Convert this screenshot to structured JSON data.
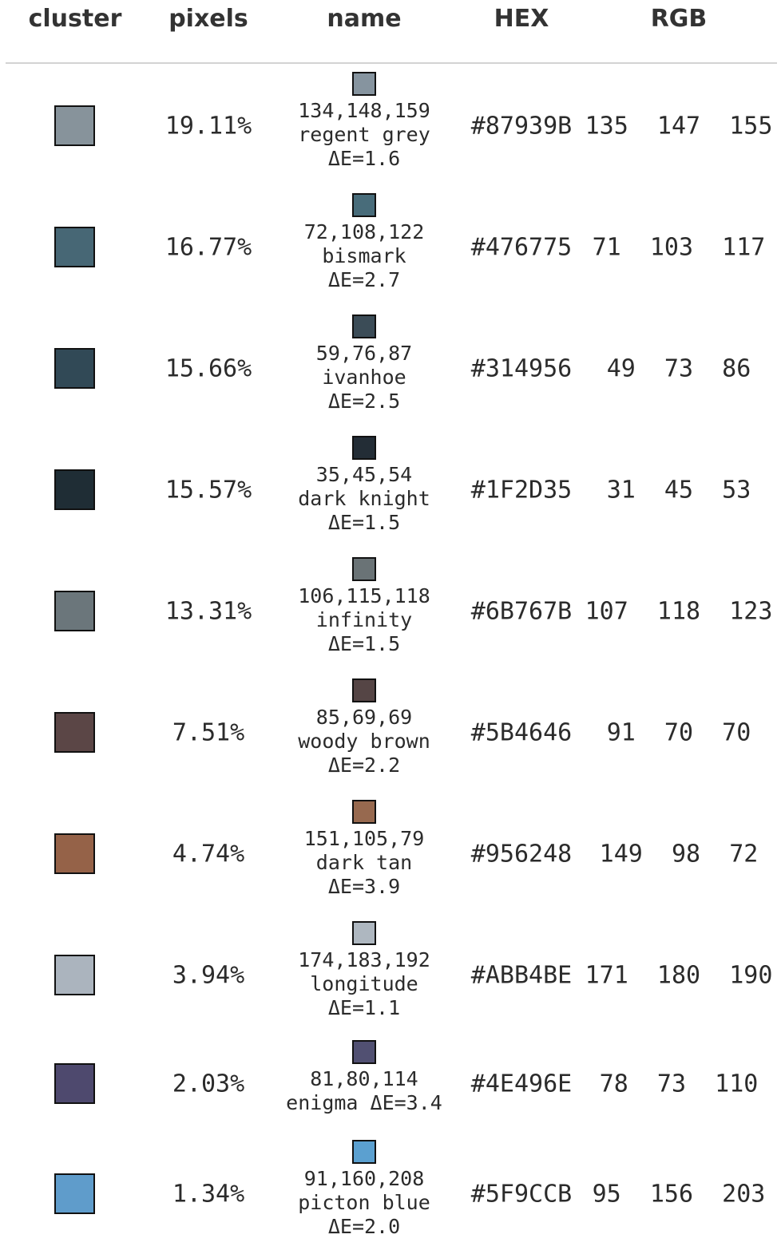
{
  "chart_data": {
    "type": "table",
    "columns": [
      "cluster",
      "pixels",
      "name",
      "HEX",
      "RGB"
    ],
    "rows": [
      {
        "color": "#87939B",
        "pixels": "19.11%",
        "name_rgb": "134,148,159",
        "name_label": "regent grey",
        "delta_e": "ΔE=1.6",
        "name_color": "#86949F",
        "hex": "#87939B",
        "rgb": "135 147 155"
      },
      {
        "color": "#476775",
        "pixels": "16.77%",
        "name_rgb": "72,108,122",
        "name_label": "bismark",
        "delta_e": "ΔE=2.7",
        "name_color": "#486C7A",
        "hex": "#476775",
        "rgb": "71 103 117"
      },
      {
        "color": "#314956",
        "pixels": "15.66%",
        "name_rgb": "59,76,87",
        "name_label": "ivanhoe",
        "delta_e": "ΔE=2.5",
        "name_color": "#3B4C57",
        "hex": "#314956",
        "rgb": "49 73 86"
      },
      {
        "color": "#1F2D35",
        "pixels": "15.57%",
        "name_rgb": "35,45,54",
        "name_label": "dark knight",
        "delta_e": "ΔE=1.5",
        "name_color": "#232D36",
        "hex": "#1F2D35",
        "rgb": "31 45 53"
      },
      {
        "color": "#6B767B",
        "pixels": "13.31%",
        "name_rgb": "106,115,118",
        "name_label": "infinity",
        "delta_e": "ΔE=1.5",
        "name_color": "#6A7376",
        "hex": "#6B767B",
        "rgb": "107 118 123"
      },
      {
        "color": "#5B4646",
        "pixels": "7.51%",
        "name_rgb": "85,69,69",
        "name_label": "woody brown",
        "delta_e": "ΔE=2.2",
        "name_color": "#554545",
        "hex": "#5B4646",
        "rgb": "91 70 70"
      },
      {
        "color": "#956248",
        "pixels": "4.74%",
        "name_rgb": "151,105,79",
        "name_label": "dark tan",
        "delta_e": "ΔE=3.9",
        "name_color": "#97694F",
        "hex": "#956248",
        "rgb": "149 98 72"
      },
      {
        "color": "#ABB4BE",
        "pixels": "3.94%",
        "name_rgb": "174,183,192",
        "name_label": "longitude",
        "delta_e": "ΔE=1.1",
        "name_color": "#AEB7C0",
        "hex": "#ABB4BE",
        "rgb": "171 180 190"
      },
      {
        "color": "#4E496E",
        "pixels": "2.03%",
        "name_rgb": "81,80,114",
        "name_label": "enigma ΔE=3.4",
        "delta_e": "",
        "name_color": "#515072",
        "hex": "#4E496E",
        "rgb": "78 73 110"
      },
      {
        "color": "#5F9CCB",
        "pixels": "1.34%",
        "name_rgb": "91,160,208",
        "name_label": "picton blue",
        "delta_e": "ΔE=2.0",
        "name_color": "#5BA0D0",
        "hex": "#5F9CCB",
        "rgb": "95 156 203"
      }
    ]
  }
}
